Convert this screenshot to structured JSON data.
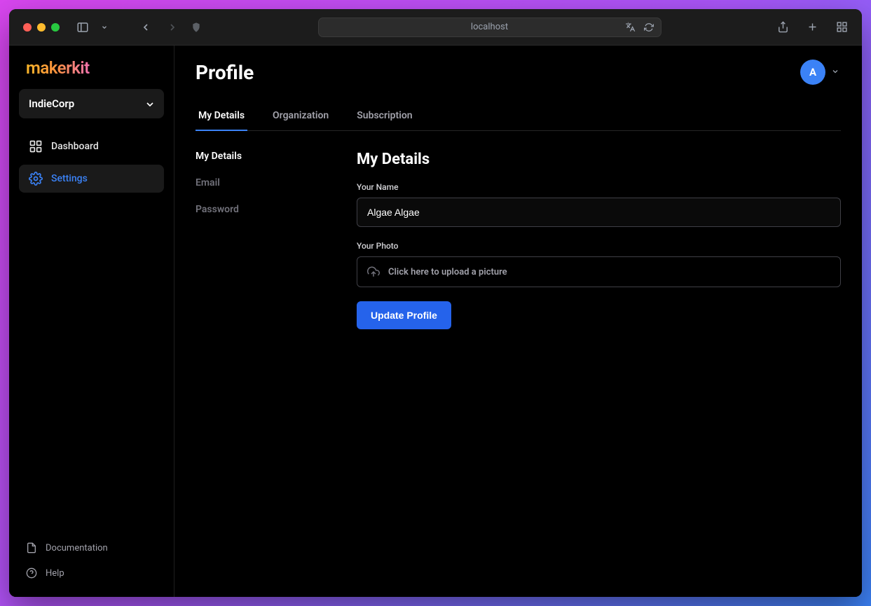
{
  "browser": {
    "address": "localhost"
  },
  "logo": "makerkit",
  "org": {
    "name": "IndieCorp"
  },
  "nav": {
    "dashboard": "Dashboard",
    "settings": "Settings"
  },
  "footer": {
    "documentation": "Documentation",
    "help": "Help"
  },
  "header": {
    "title": "Profile",
    "avatar_initial": "A"
  },
  "tabs": {
    "my_details": "My Details",
    "organization": "Organization",
    "subscription": "Subscription"
  },
  "subnav": {
    "my_details": "My Details",
    "email": "Email",
    "password": "Password"
  },
  "form": {
    "section_title": "My Details",
    "name_label": "Your Name",
    "name_value": "Algae Algae",
    "photo_label": "Your Photo",
    "upload_text": "Click here to upload a picture",
    "submit": "Update Profile"
  }
}
